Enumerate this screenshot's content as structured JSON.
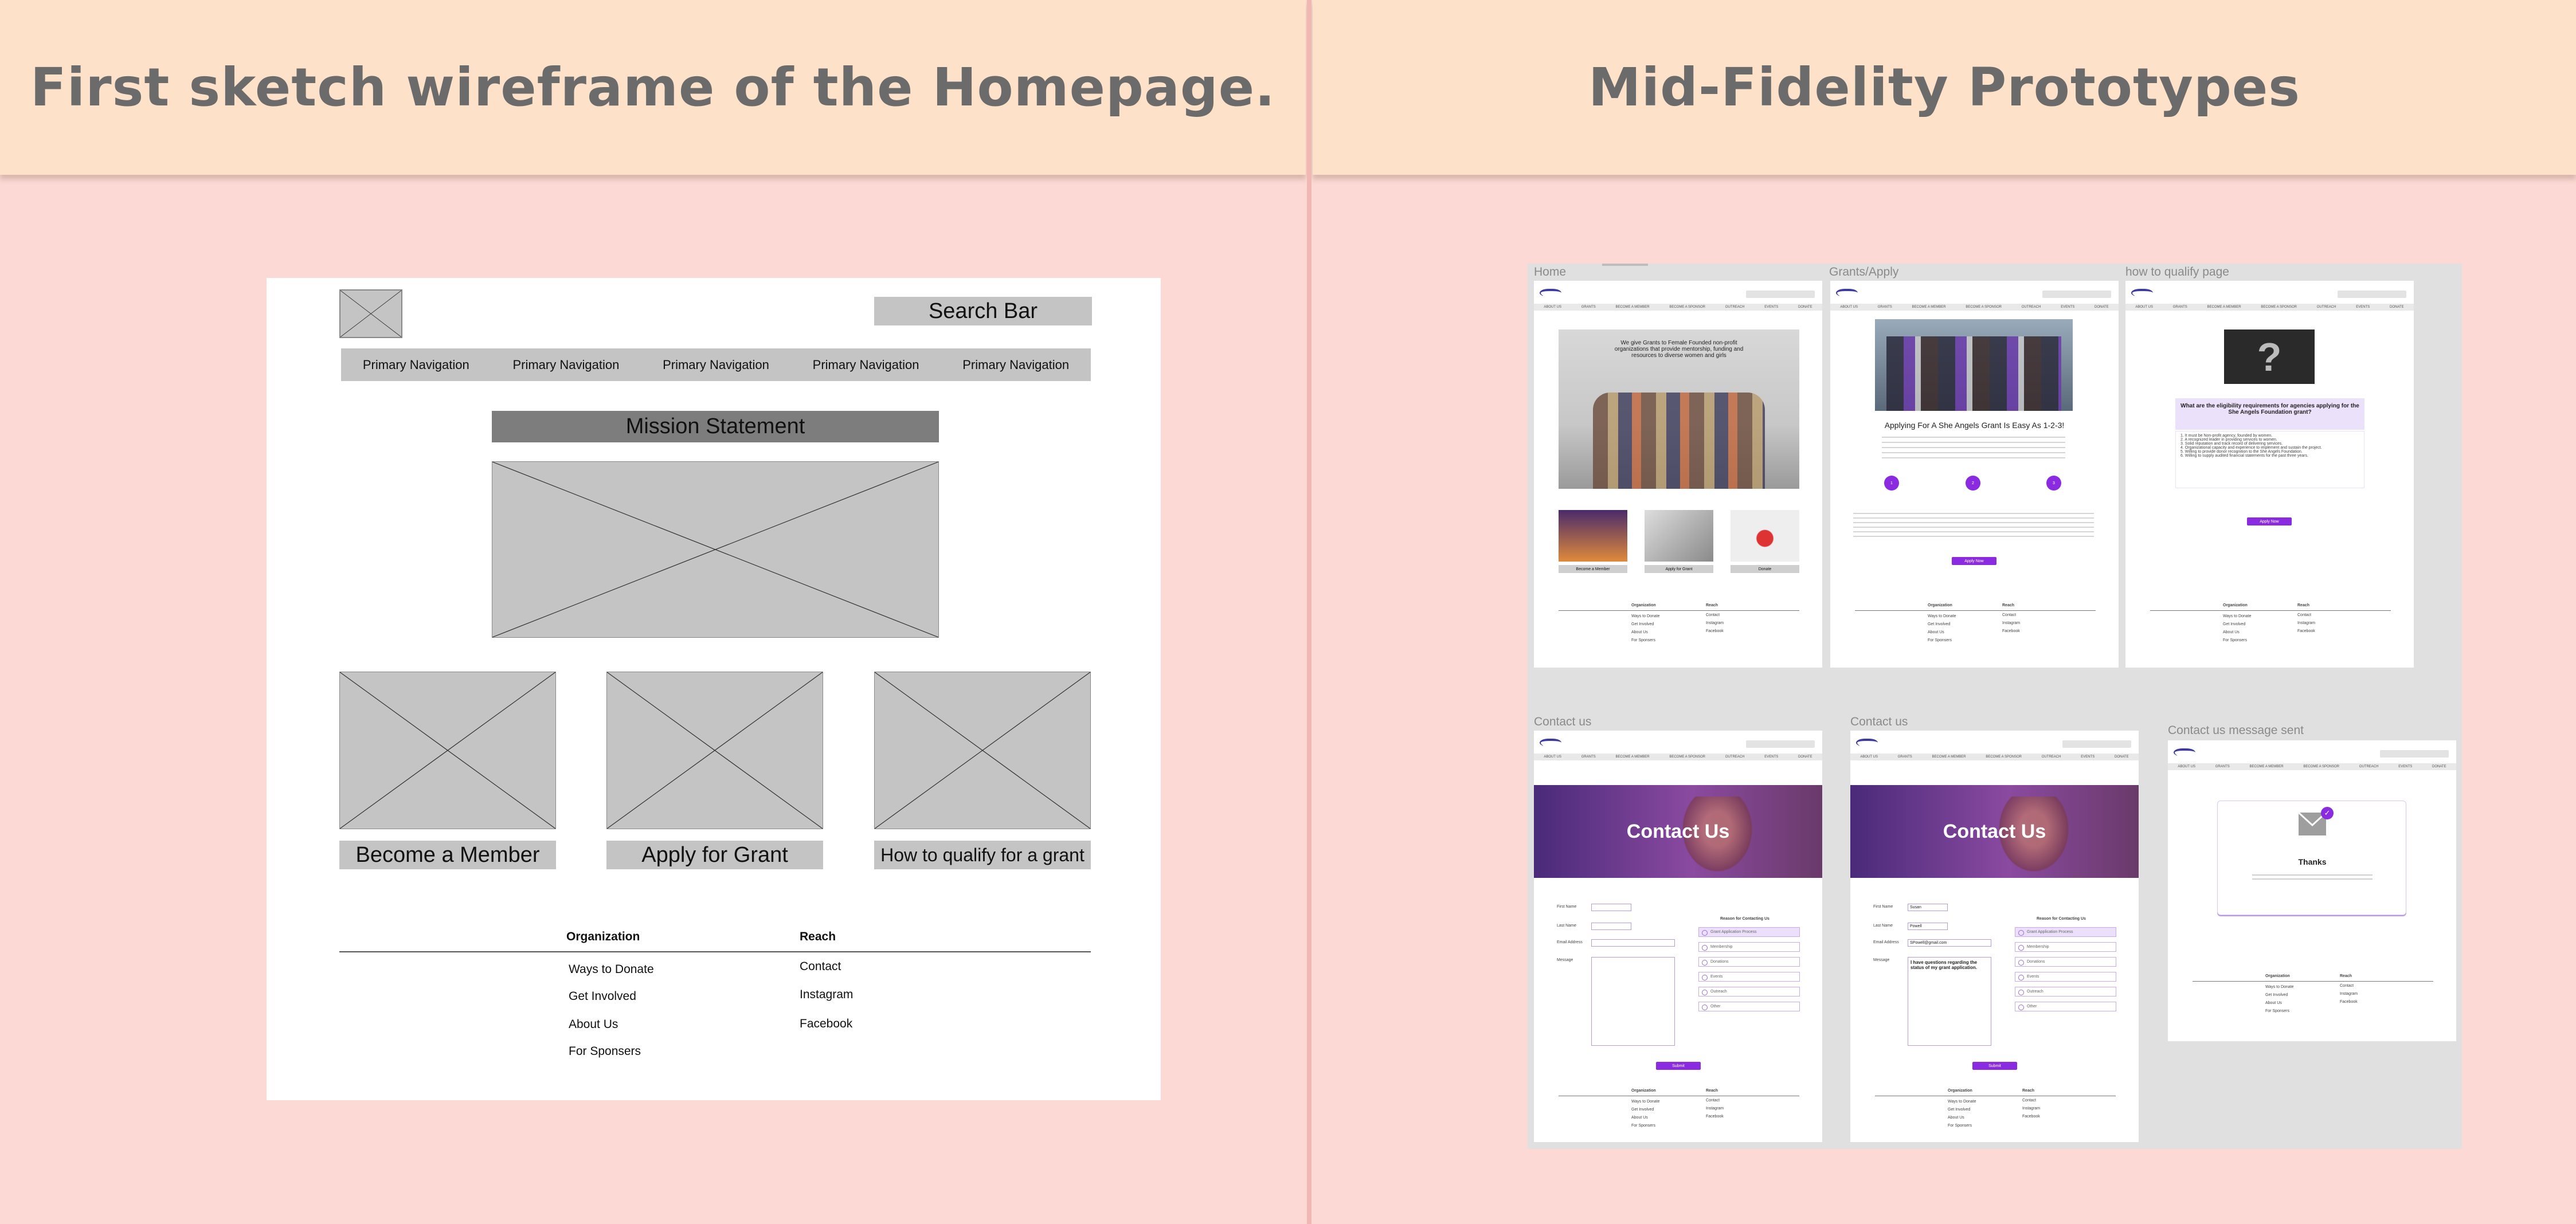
{
  "headers": {
    "left": "First sketch wireframe of the Homepage.",
    "right": "Mid-Fidelity Prototypes"
  },
  "wireframe": {
    "search_bar": "Search Bar",
    "nav_items": [
      "Primary Navigation",
      "Primary Navigation",
      "Primary Navigation",
      "Primary Navigation",
      "Primary Navigation"
    ],
    "mission_statement": "Mission Statement",
    "cards": [
      "Become a Member",
      "Apply for Grant",
      "How to qualify for a grant"
    ],
    "footer": {
      "col1_title": "Organization",
      "col1_links": [
        "Ways to Donate",
        "Get Involved",
        "About Us",
        "For Sponsers"
      ],
      "col2_title": "Reach",
      "col2_links": [
        "Contact",
        "Instagram",
        "Facebook"
      ]
    }
  },
  "prototypes": {
    "labels": {
      "home": "Home",
      "grants": "Grants/Apply",
      "qualify": "how to qualify page",
      "contact1": "Contact us",
      "contact2": "Contact us",
      "sent": "Contact us message sent"
    },
    "nav_items": [
      "ABOUT US",
      "GRANTS",
      "BECOME A MEMBER",
      "BECOME A SPONSOR",
      "OUTREACH",
      "EVENTS",
      "DONATE"
    ],
    "home": {
      "mission": "We give Grants to Female Founded non-profit organizations that provide mentorship, funding and resources to diverse women and girls",
      "cards": [
        "Become a Member",
        "Apply for Grant",
        "Donate"
      ]
    },
    "grants": {
      "heading": "Applying For A She Angels Grant Is Easy As 1-2-3!",
      "steps": [
        "1",
        "2",
        "3"
      ],
      "apply": "Apply Now"
    },
    "qualify": {
      "question": "What are the eligibility requirements for agencies applying for the She Angels Foundation grant?",
      "criteria": [
        "1. It must be Non-profit agency, founded by women.",
        "2. A recognized leader in providing services to women.",
        "3. Solid reputation and track record of delivering services.",
        "4. Organizational capacity and experience to implement and sustain the project.",
        "5. Willing to provide donor recognition to the She Angels Foundation.",
        "6. Willing to supply audited financial statements for the past three years."
      ],
      "apply": "Apply Now"
    },
    "contact": {
      "hero_title": "Contact Us",
      "first_name": "First Name",
      "last_name": "Last Name",
      "email": "Email Address",
      "message": "Message",
      "reason_title": "Reason for Contacting Us",
      "reasons": [
        "Grant Application Process",
        "Membership",
        "Donations",
        "Events",
        "Outreach",
        "Other"
      ],
      "submit": "Submit",
      "filled_first": "Susan",
      "filled_last": "Powell",
      "filled_email": "SPowell@gmail.com",
      "filled_message": "I have questions regarding the status of my grant application."
    },
    "sent": {
      "thanks": "Thanks"
    },
    "footer": {
      "col1_title": "Organization",
      "col1_links": [
        "Ways to Donate",
        "Get Involved",
        "About Us",
        "For Sponsers"
      ],
      "col2_title": "Reach",
      "col2_links": [
        "Contact",
        "Instagram",
        "Facebook"
      ]
    }
  }
}
